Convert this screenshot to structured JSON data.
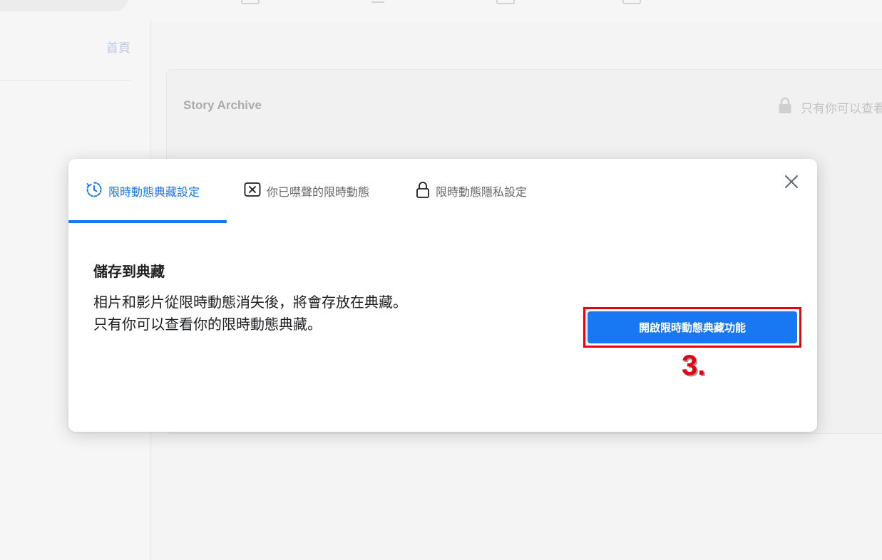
{
  "background": {
    "home_link": "首頁",
    "card_title": "Story Archive",
    "privacy_text": "只有你可以查看"
  },
  "modal": {
    "tabs": [
      {
        "label": "限時動態典藏設定",
        "icon": "archive-clock-icon",
        "active": true
      },
      {
        "label": "你已噤聲的限時動態",
        "icon": "muted-x-icon",
        "active": false
      },
      {
        "label": "限時動態隱私設定",
        "icon": "lock-icon",
        "active": false
      }
    ],
    "section_title": "儲存到典藏",
    "section_description": "相片和影片從限時動態消失後，將會存放在典藏。只有你可以查看你的限時動態典藏。",
    "enable_button_label": "開啟限時動態典藏功能",
    "step_marker": "3."
  },
  "colors": {
    "accent": "#1877f2",
    "annotation_red": "#e60012"
  }
}
